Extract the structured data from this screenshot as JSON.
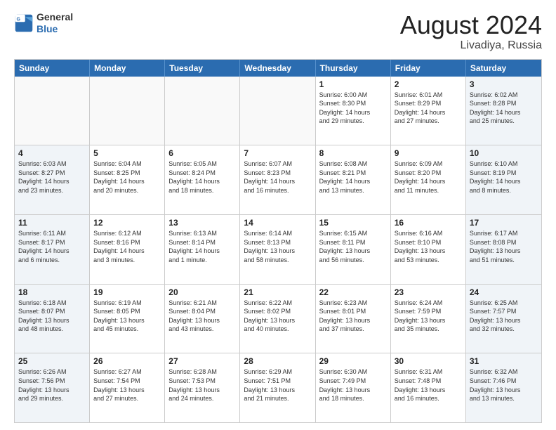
{
  "logo": {
    "general": "General",
    "blue": "Blue"
  },
  "title": "August 2024",
  "location": "Livadiya, Russia",
  "weekdays": [
    "Sunday",
    "Monday",
    "Tuesday",
    "Wednesday",
    "Thursday",
    "Friday",
    "Saturday"
  ],
  "rows": [
    [
      {
        "day": "",
        "info": "",
        "empty": true
      },
      {
        "day": "",
        "info": "",
        "empty": true
      },
      {
        "day": "",
        "info": "",
        "empty": true
      },
      {
        "day": "",
        "info": "",
        "empty": true
      },
      {
        "day": "1",
        "info": "Sunrise: 6:00 AM\nSunset: 8:30 PM\nDaylight: 14 hours\nand 29 minutes."
      },
      {
        "day": "2",
        "info": "Sunrise: 6:01 AM\nSunset: 8:29 PM\nDaylight: 14 hours\nand 27 minutes."
      },
      {
        "day": "3",
        "info": "Sunrise: 6:02 AM\nSunset: 8:28 PM\nDaylight: 14 hours\nand 25 minutes."
      }
    ],
    [
      {
        "day": "4",
        "info": "Sunrise: 6:03 AM\nSunset: 8:27 PM\nDaylight: 14 hours\nand 23 minutes."
      },
      {
        "day": "5",
        "info": "Sunrise: 6:04 AM\nSunset: 8:25 PM\nDaylight: 14 hours\nand 20 minutes."
      },
      {
        "day": "6",
        "info": "Sunrise: 6:05 AM\nSunset: 8:24 PM\nDaylight: 14 hours\nand 18 minutes."
      },
      {
        "day": "7",
        "info": "Sunrise: 6:07 AM\nSunset: 8:23 PM\nDaylight: 14 hours\nand 16 minutes."
      },
      {
        "day": "8",
        "info": "Sunrise: 6:08 AM\nSunset: 8:21 PM\nDaylight: 14 hours\nand 13 minutes."
      },
      {
        "day": "9",
        "info": "Sunrise: 6:09 AM\nSunset: 8:20 PM\nDaylight: 14 hours\nand 11 minutes."
      },
      {
        "day": "10",
        "info": "Sunrise: 6:10 AM\nSunset: 8:19 PM\nDaylight: 14 hours\nand 8 minutes."
      }
    ],
    [
      {
        "day": "11",
        "info": "Sunrise: 6:11 AM\nSunset: 8:17 PM\nDaylight: 14 hours\nand 6 minutes."
      },
      {
        "day": "12",
        "info": "Sunrise: 6:12 AM\nSunset: 8:16 PM\nDaylight: 14 hours\nand 3 minutes."
      },
      {
        "day": "13",
        "info": "Sunrise: 6:13 AM\nSunset: 8:14 PM\nDaylight: 14 hours\nand 1 minute."
      },
      {
        "day": "14",
        "info": "Sunrise: 6:14 AM\nSunset: 8:13 PM\nDaylight: 13 hours\nand 58 minutes."
      },
      {
        "day": "15",
        "info": "Sunrise: 6:15 AM\nSunset: 8:11 PM\nDaylight: 13 hours\nand 56 minutes."
      },
      {
        "day": "16",
        "info": "Sunrise: 6:16 AM\nSunset: 8:10 PM\nDaylight: 13 hours\nand 53 minutes."
      },
      {
        "day": "17",
        "info": "Sunrise: 6:17 AM\nSunset: 8:08 PM\nDaylight: 13 hours\nand 51 minutes."
      }
    ],
    [
      {
        "day": "18",
        "info": "Sunrise: 6:18 AM\nSunset: 8:07 PM\nDaylight: 13 hours\nand 48 minutes."
      },
      {
        "day": "19",
        "info": "Sunrise: 6:19 AM\nSunset: 8:05 PM\nDaylight: 13 hours\nand 45 minutes."
      },
      {
        "day": "20",
        "info": "Sunrise: 6:21 AM\nSunset: 8:04 PM\nDaylight: 13 hours\nand 43 minutes."
      },
      {
        "day": "21",
        "info": "Sunrise: 6:22 AM\nSunset: 8:02 PM\nDaylight: 13 hours\nand 40 minutes."
      },
      {
        "day": "22",
        "info": "Sunrise: 6:23 AM\nSunset: 8:01 PM\nDaylight: 13 hours\nand 37 minutes."
      },
      {
        "day": "23",
        "info": "Sunrise: 6:24 AM\nSunset: 7:59 PM\nDaylight: 13 hours\nand 35 minutes."
      },
      {
        "day": "24",
        "info": "Sunrise: 6:25 AM\nSunset: 7:57 PM\nDaylight: 13 hours\nand 32 minutes."
      }
    ],
    [
      {
        "day": "25",
        "info": "Sunrise: 6:26 AM\nSunset: 7:56 PM\nDaylight: 13 hours\nand 29 minutes."
      },
      {
        "day": "26",
        "info": "Sunrise: 6:27 AM\nSunset: 7:54 PM\nDaylight: 13 hours\nand 27 minutes."
      },
      {
        "day": "27",
        "info": "Sunrise: 6:28 AM\nSunset: 7:53 PM\nDaylight: 13 hours\nand 24 minutes."
      },
      {
        "day": "28",
        "info": "Sunrise: 6:29 AM\nSunset: 7:51 PM\nDaylight: 13 hours\nand 21 minutes."
      },
      {
        "day": "29",
        "info": "Sunrise: 6:30 AM\nSunset: 7:49 PM\nDaylight: 13 hours\nand 18 minutes."
      },
      {
        "day": "30",
        "info": "Sunrise: 6:31 AM\nSunset: 7:48 PM\nDaylight: 13 hours\nand 16 minutes."
      },
      {
        "day": "31",
        "info": "Sunrise: 6:32 AM\nSunset: 7:46 PM\nDaylight: 13 hours\nand 13 minutes."
      }
    ]
  ]
}
